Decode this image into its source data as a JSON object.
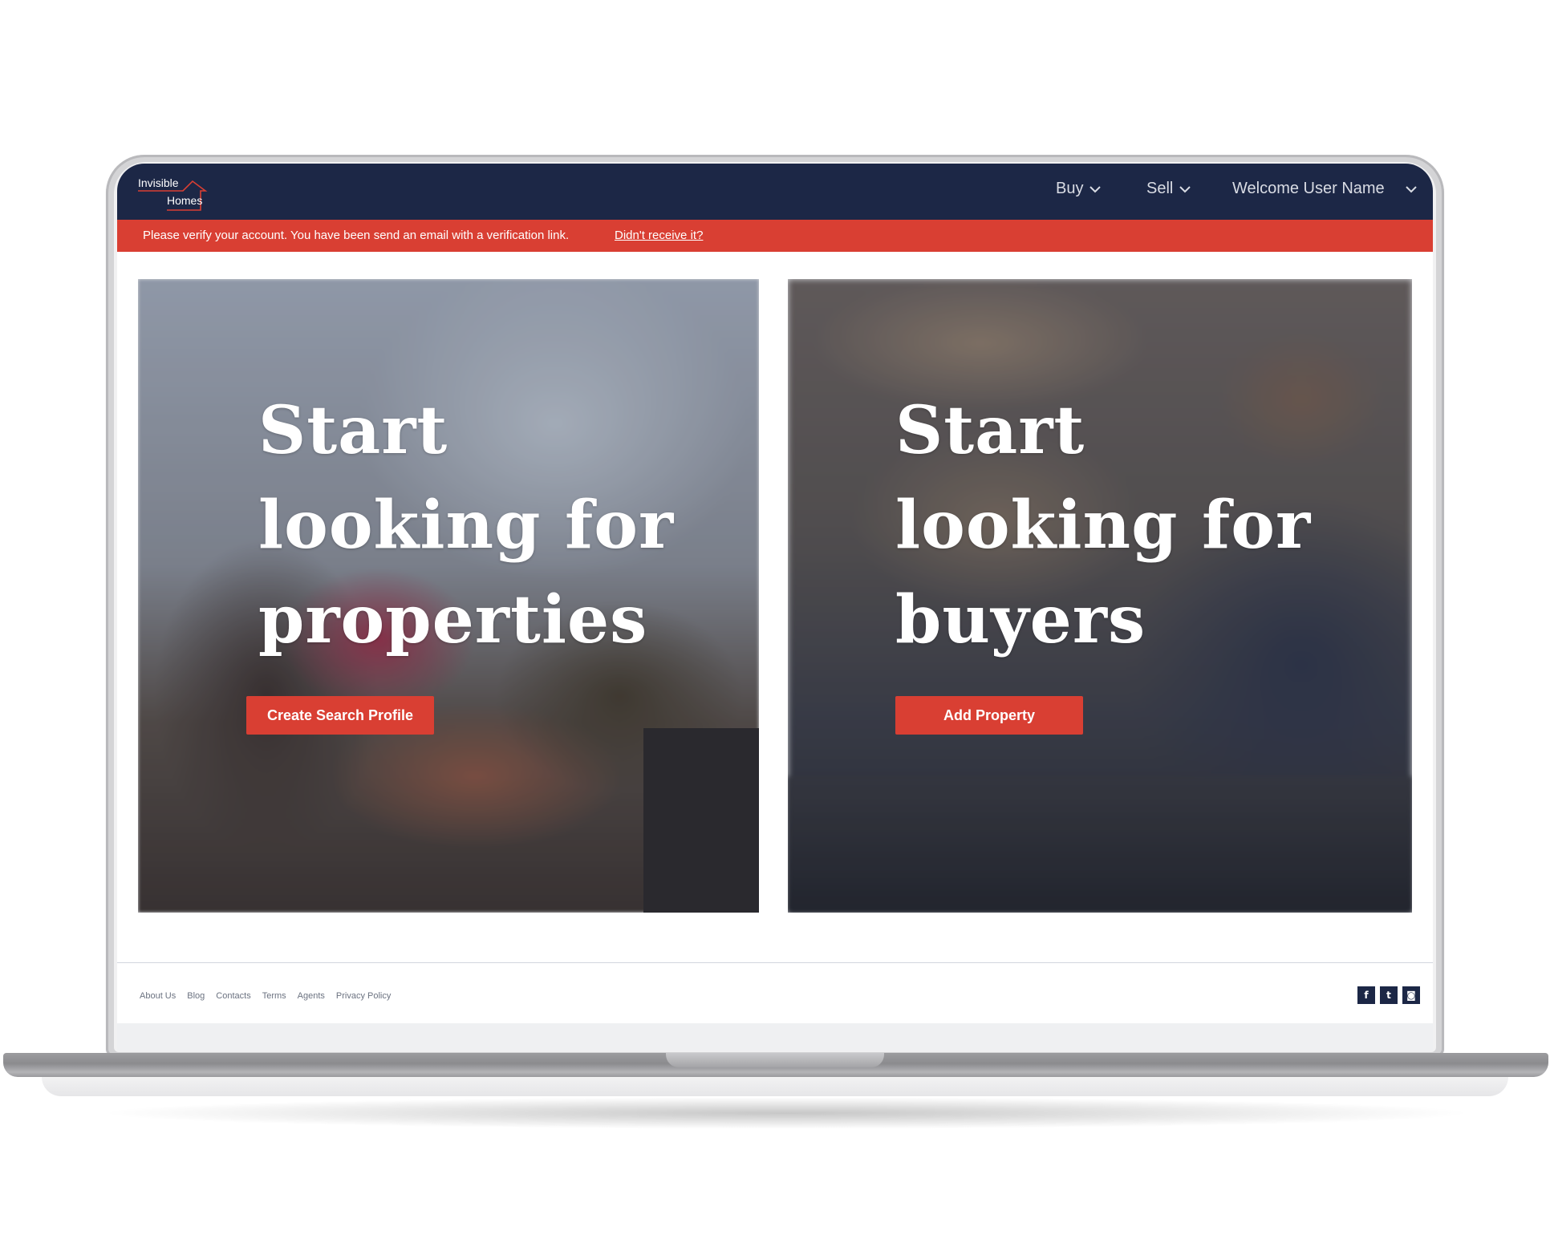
{
  "brand": {
    "logo_line1": "Invisible",
    "logo_line2": "Homes",
    "navy": "#1c2746",
    "accent": "#d93f33"
  },
  "nav": {
    "buy": "Buy",
    "sell": "Sell",
    "user": "Welcome User Name",
    "chevron_icon": "chevron-down-icon"
  },
  "alert": {
    "message": "Please verify your account. You have been send an email with a verification link.",
    "link": "Didn't receive it?"
  },
  "cards": {
    "left": {
      "line1": "Start",
      "line2": "looking for",
      "line3": "properties",
      "button": "Create Search Profile"
    },
    "right": {
      "line1": "Start",
      "line2": "looking for",
      "line3": "buyers",
      "button": "Add Property"
    }
  },
  "footer": {
    "links": [
      "About Us",
      "Blog",
      "Contacts",
      "Terms",
      "Agents",
      "Privacy Policy"
    ],
    "social": {
      "facebook": "f",
      "twitter": "t",
      "instagram": "◙"
    }
  }
}
